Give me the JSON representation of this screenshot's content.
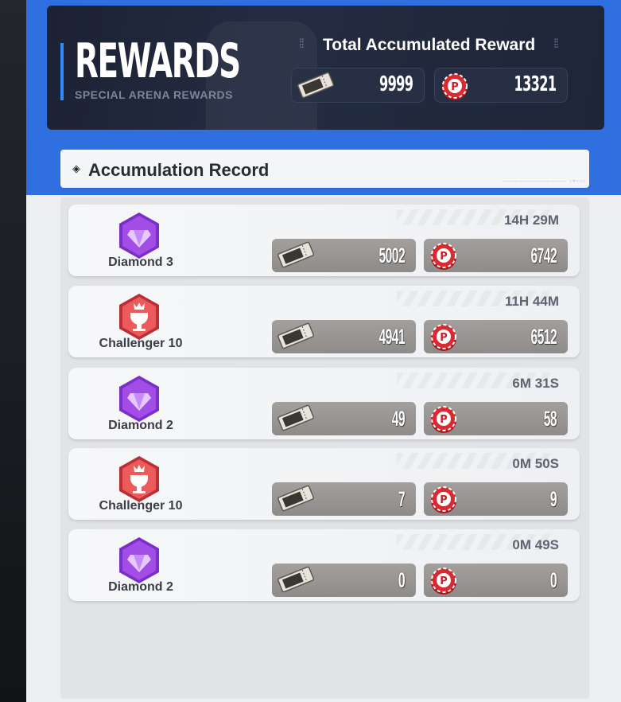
{
  "header": {
    "title": "REWARDS",
    "subtitle": "SPECIAL ARENA REWARDS",
    "total_title": "Total Accumulated Reward",
    "total_ticket": "9999",
    "total_coin": "13321"
  },
  "section": {
    "title": "Accumulation Record"
  },
  "records": [
    {
      "rank": "Diamond 3",
      "tier": "diamond",
      "time": "14H 29M",
      "ticket": "5002",
      "coin": "6742"
    },
    {
      "rank": "Challenger 10",
      "tier": "challenger",
      "time": "11H 44M",
      "ticket": "4941",
      "coin": "6512"
    },
    {
      "rank": "Diamond 2",
      "tier": "diamond",
      "time": "6M 31S",
      "ticket": "49",
      "coin": "58"
    },
    {
      "rank": "Challenger 10",
      "tier": "challenger",
      "time": "0M 50S",
      "ticket": "7",
      "coin": "9"
    },
    {
      "rank": "Diamond 2",
      "tier": "diamond",
      "time": "0M 49S",
      "ticket": "0",
      "coin": "0"
    }
  ],
  "colors": {
    "accent_blue": "#2f6fe0",
    "diamond_purple": "#9b4de0",
    "challenger_red": "#e0474a",
    "coin_red": "#c8202a"
  },
  "icons": {
    "ticket": "ticket-icon",
    "coin": "p-coin-icon",
    "diamond": "diamond-rank-icon",
    "challenger": "challenger-rank-icon"
  }
}
